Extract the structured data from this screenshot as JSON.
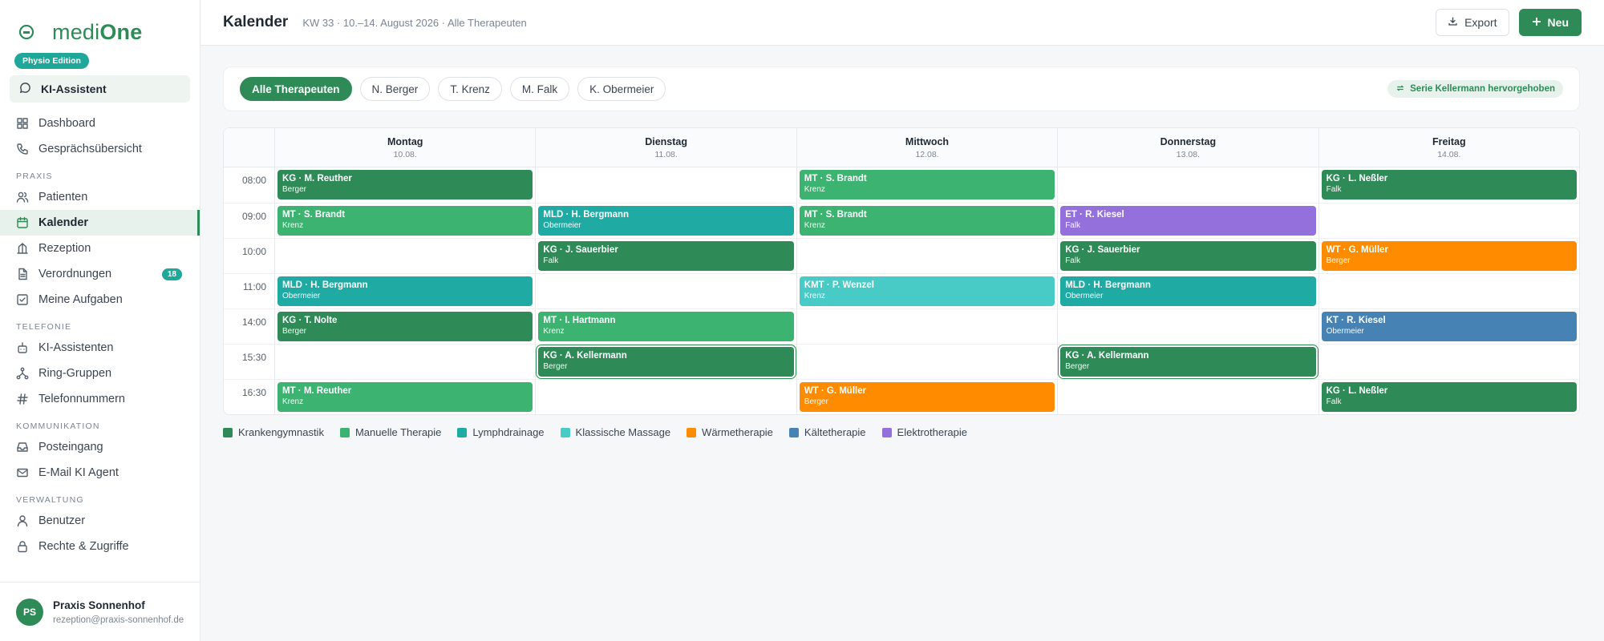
{
  "brand": {
    "name_light": "medi",
    "name_bold": "One",
    "edition": "Physio Edition"
  },
  "ki_assistant": {
    "label": "KI-Assistent"
  },
  "nav": {
    "top": [
      {
        "label": "Dashboard",
        "icon": "grid-icon"
      },
      {
        "label": "Gesprächsübersicht",
        "icon": "phone-icon"
      }
    ],
    "sections": [
      {
        "title": "PRAXIS",
        "items": [
          {
            "label": "Patienten",
            "icon": "users-icon"
          },
          {
            "label": "Kalender",
            "icon": "calendar-icon",
            "active": true
          },
          {
            "label": "Rezeption",
            "icon": "building-icon"
          },
          {
            "label": "Verordnungen",
            "icon": "document-icon",
            "badge": "18"
          },
          {
            "label": "Meine Aufgaben",
            "icon": "checkbox-icon"
          }
        ]
      },
      {
        "title": "TELEFONIE",
        "items": [
          {
            "label": "KI-Assistenten",
            "icon": "bot-icon"
          },
          {
            "label": "Ring-Gruppen",
            "icon": "network-icon"
          },
          {
            "label": "Telefonnummern",
            "icon": "hash-icon"
          }
        ]
      },
      {
        "title": "KOMMUNIKATION",
        "items": [
          {
            "label": "Posteingang",
            "icon": "inbox-icon"
          },
          {
            "label": "E-Mail KI Agent",
            "icon": "mail-icon"
          }
        ]
      },
      {
        "title": "VERWALTUNG",
        "items": [
          {
            "label": "Benutzer",
            "icon": "user-icon"
          },
          {
            "label": "Rechte & Zugriffe",
            "icon": "lock-icon"
          }
        ]
      }
    ]
  },
  "user": {
    "initials": "PS",
    "name": "Praxis Sonnenhof",
    "email": "rezeption@praxis-sonnenhof.de"
  },
  "header": {
    "title": "Kalender",
    "subtitle": "KW 33 · 10.–14. August 2026 · Alle Therapeuten",
    "export_label": "Export",
    "new_label": "Neu"
  },
  "filters": {
    "chips": [
      "Alle Therapeuten",
      "N. Berger",
      "T. Krenz",
      "M. Falk",
      "K. Obermeier"
    ],
    "active_index": 0,
    "serie_tag": "Serie Kellermann hervorgehoben"
  },
  "colors": {
    "KG": "#2e8b57",
    "MT": "#3cb371",
    "MLD": "#20aaa4",
    "KMT": "#48cbc7",
    "WT": "#ff8c00",
    "KT": "#4682b4",
    "ET": "#9370db"
  },
  "calendar": {
    "days": [
      {
        "name": "Montag",
        "date": "10.08."
      },
      {
        "name": "Dienstag",
        "date": "11.08."
      },
      {
        "name": "Mittwoch",
        "date": "12.08."
      },
      {
        "name": "Donnerstag",
        "date": "13.08."
      },
      {
        "name": "Freitag",
        "date": "14.08."
      }
    ],
    "rows": [
      {
        "time": "08:00",
        "cells": [
          {
            "type": "KG",
            "title": "KG · M. Reuther",
            "therapist": "Berger"
          },
          null,
          {
            "type": "MT",
            "title": "MT · S. Brandt",
            "therapist": "Krenz"
          },
          null,
          {
            "type": "KG",
            "title": "KG · L. Neßler",
            "therapist": "Falk"
          }
        ]
      },
      {
        "time": "09:00",
        "cells": [
          {
            "type": "MT",
            "title": "MT · S. Brandt",
            "therapist": "Krenz"
          },
          {
            "type": "MLD",
            "title": "MLD · H. Bergmann",
            "therapist": "Obermeier"
          },
          {
            "type": "MT",
            "title": "MT · S. Brandt",
            "therapist": "Krenz"
          },
          {
            "type": "ET",
            "title": "ET · R. Kiesel",
            "therapist": "Falk"
          },
          null
        ]
      },
      {
        "time": "10:00",
        "cells": [
          null,
          {
            "type": "KG",
            "title": "KG · J. Sauerbier",
            "therapist": "Falk"
          },
          null,
          {
            "type": "KG",
            "title": "KG · J. Sauerbier",
            "therapist": "Falk"
          },
          {
            "type": "WT",
            "title": "WT · G. Müller",
            "therapist": "Berger"
          }
        ]
      },
      {
        "time": "11:00",
        "cells": [
          {
            "type": "MLD",
            "title": "MLD · H. Bergmann",
            "therapist": "Obermeier"
          },
          null,
          {
            "type": "KMT",
            "title": "KMT · P. Wenzel",
            "therapist": "Krenz"
          },
          {
            "type": "MLD",
            "title": "MLD · H. Bergmann",
            "therapist": "Obermeier"
          },
          null
        ]
      },
      {
        "time": "14:00",
        "cells": [
          {
            "type": "KG",
            "title": "KG · T. Nolte",
            "therapist": "Berger"
          },
          {
            "type": "MT",
            "title": "MT · I. Hartmann",
            "therapist": "Krenz"
          },
          null,
          null,
          {
            "type": "KT",
            "title": "KT · R. Kiesel",
            "therapist": "Obermeier"
          }
        ]
      },
      {
        "time": "15:30",
        "cells": [
          null,
          {
            "type": "KG",
            "title": "KG · A. Kellermann",
            "therapist": "Berger",
            "highlight": true
          },
          null,
          {
            "type": "KG",
            "title": "KG · A. Kellermann",
            "therapist": "Berger",
            "highlight": true
          },
          null
        ]
      },
      {
        "time": "16:30",
        "cells": [
          {
            "type": "MT",
            "title": "MT · M. Reuther",
            "therapist": "Krenz"
          },
          null,
          {
            "type": "WT",
            "title": "WT · G. Müller",
            "therapist": "Berger"
          },
          null,
          {
            "type": "KG",
            "title": "KG · L. Neßler",
            "therapist": "Falk"
          }
        ]
      }
    ]
  },
  "legend": [
    {
      "type": "KG",
      "label": "Krankengymnastik"
    },
    {
      "type": "MT",
      "label": "Manuelle Therapie"
    },
    {
      "type": "MLD",
      "label": "Lymphdrainage"
    },
    {
      "type": "KMT",
      "label": "Klassische Massage"
    },
    {
      "type": "WT",
      "label": "Wärmetherapie"
    },
    {
      "type": "KT",
      "label": "Kältetherapie"
    },
    {
      "type": "ET",
      "label": "Elektrotherapie"
    }
  ]
}
